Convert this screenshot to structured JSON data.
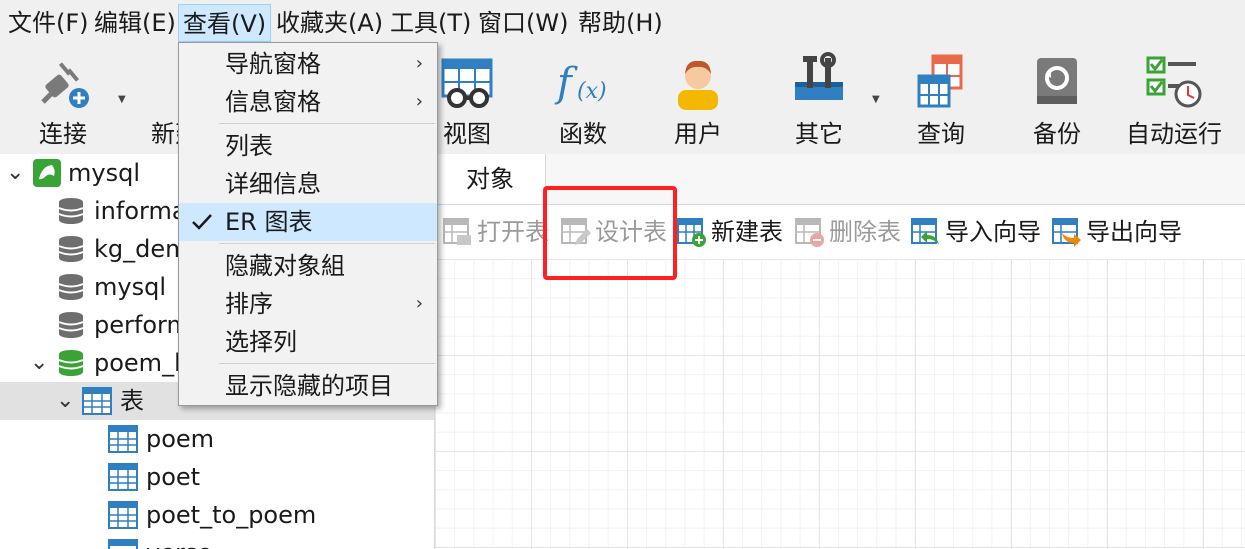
{
  "menubar": {
    "items": [
      {
        "label": "文件(F)"
      },
      {
        "label": "编辑(E)"
      },
      {
        "label": "查看(V)"
      },
      {
        "label": "收藏夹(A)"
      },
      {
        "label": "工具(T)"
      },
      {
        "label": "窗口(W)"
      },
      {
        "label": "帮助(H)"
      }
    ]
  },
  "toolbar": {
    "items": [
      {
        "label": "连接",
        "icon": "plug-connect-icon"
      },
      {
        "label": "新建",
        "icon": "new-table-icon"
      },
      {
        "label": "视图",
        "icon": "view-icon"
      },
      {
        "label": "函数",
        "icon": "function-icon"
      },
      {
        "label": "用户",
        "icon": "user-icon"
      },
      {
        "label": "其它",
        "icon": "tools-icon"
      },
      {
        "label": "查询",
        "icon": "query-icon"
      },
      {
        "label": "备份",
        "icon": "backup-icon"
      },
      {
        "label": "自动运行",
        "icon": "schedule-icon"
      }
    ]
  },
  "dropdown": {
    "items": [
      {
        "label": "导航窗格",
        "submenu": "›"
      },
      {
        "label": "信息窗格",
        "submenu": "›"
      },
      {
        "label": "列表"
      },
      {
        "label": "详细信息"
      },
      {
        "label": "ER 图表"
      },
      {
        "label": "隐藏对象組"
      },
      {
        "label": "排序",
        "submenu": "›"
      },
      {
        "label": "选择列"
      },
      {
        "label": "显示隐藏的项目"
      }
    ]
  },
  "tree": {
    "items": [
      {
        "label": "mysql"
      },
      {
        "label": "informa"
      },
      {
        "label": "kg_dem"
      },
      {
        "label": "mysql"
      },
      {
        "label": "perform"
      },
      {
        "label": "poem_k"
      },
      {
        "label": "表"
      },
      {
        "label": "poem"
      },
      {
        "label": "poet"
      },
      {
        "label": "poet_to_poem"
      },
      {
        "label": "verse"
      }
    ]
  },
  "tabs": {
    "objects": "对象"
  },
  "object_toolbar": {
    "items": [
      {
        "label": "打开表"
      },
      {
        "label": "设计表"
      },
      {
        "label": "新建表"
      },
      {
        "label": "删除表"
      },
      {
        "label": "导入向导"
      },
      {
        "label": "导出向导"
      }
    ]
  },
  "colors": {
    "menu_highlight": "#cde8ff",
    "annotation_box": "#ff2020",
    "table_blue": "#2f7fc1",
    "db_green": "#3aa335"
  }
}
